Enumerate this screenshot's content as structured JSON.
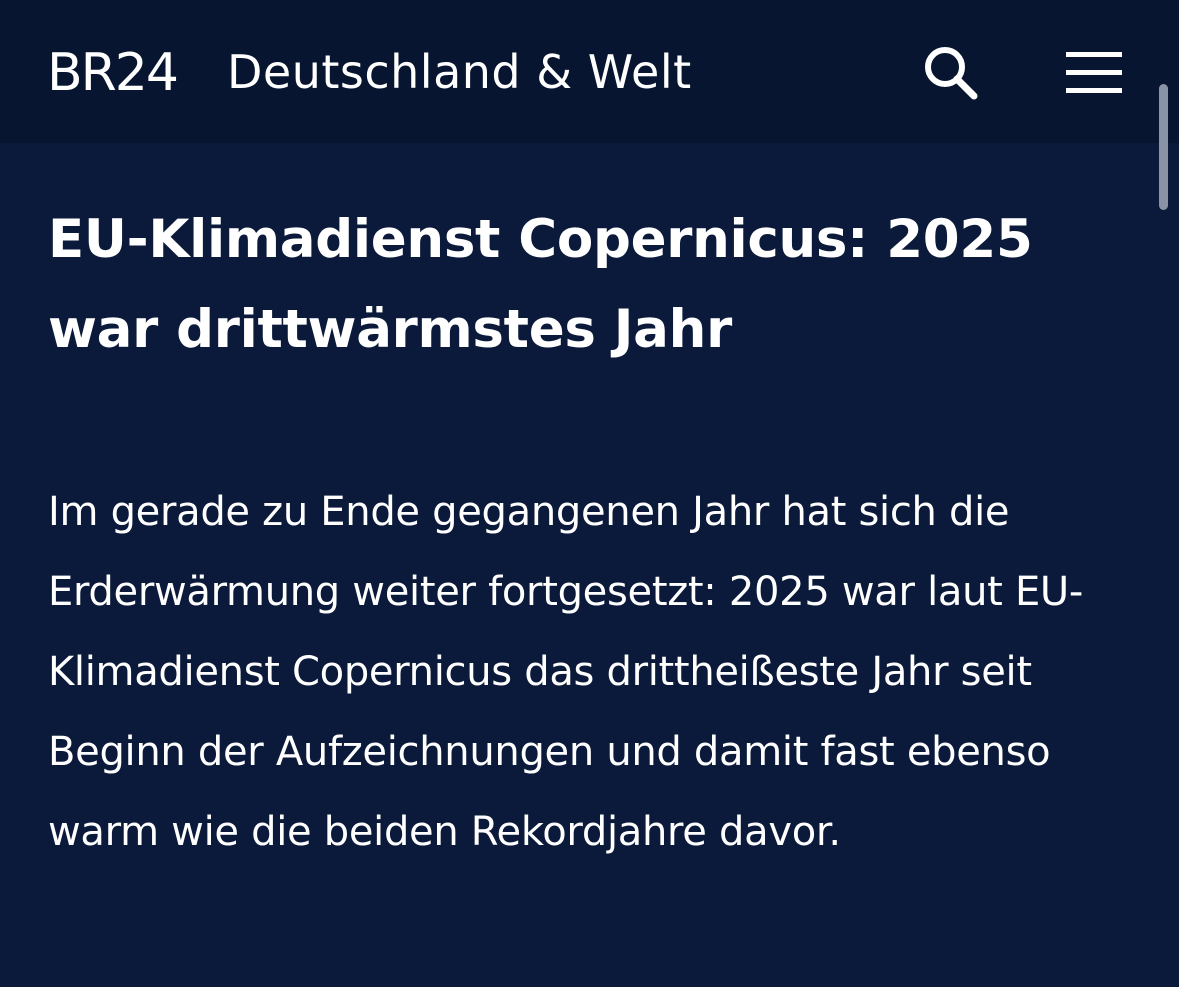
{
  "header": {
    "logo_text": "BR24",
    "section_title": "Deutschland & Welt",
    "search_icon": "search-icon",
    "menu_icon": "hamburger-menu-icon"
  },
  "article": {
    "headline": "EU-Klimadienst Copernicus: 2025 war drittwärmstes Jahr",
    "lead": "Im gerade zu Ende gegangenen Jahr hat sich die Erderwärmung weiter fortgesetzt: 2025 war laut EU-Klimadienst Copernicus das drittheißeste Jahr seit Beginn der Aufzeichnungen und damit fast ebenso warm wie die beiden Rekordjahre davor."
  },
  "colors": {
    "page_background": "#0b1a3a",
    "header_background": "#071530",
    "text": "#ffffff"
  }
}
